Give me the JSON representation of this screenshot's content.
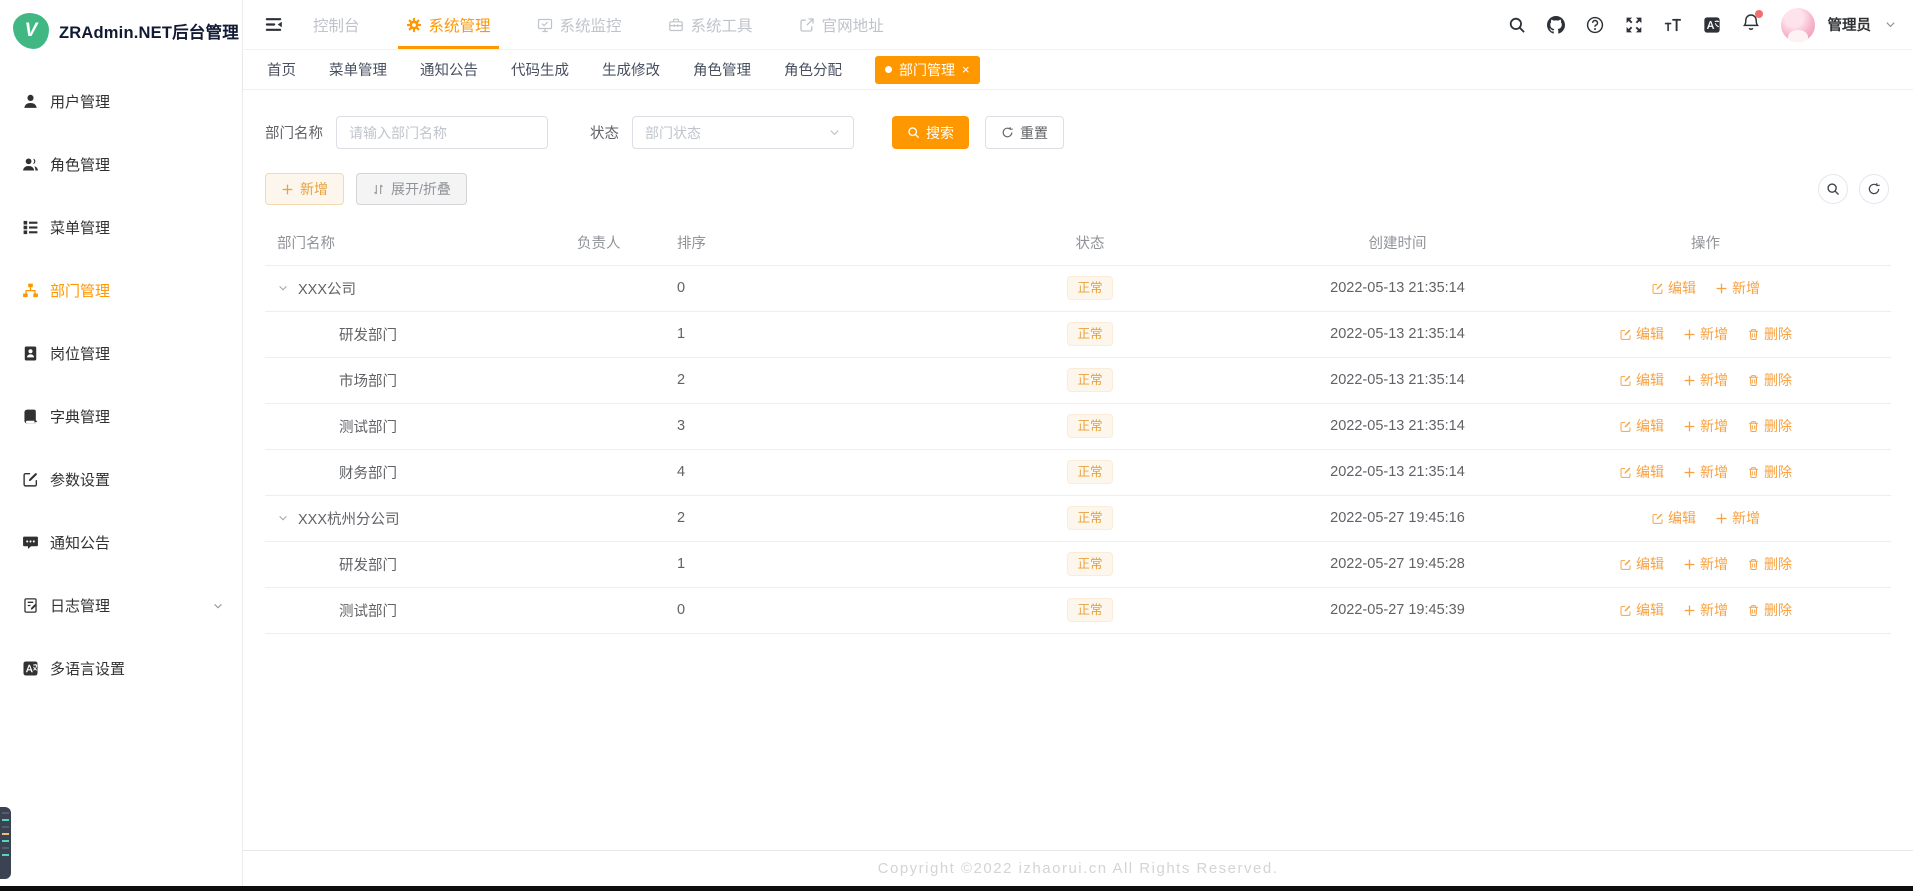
{
  "app": {
    "title": "ZRAdmin.NET后台管理",
    "logo_letter": "V"
  },
  "colors": {
    "accent": "#ff9700",
    "logo_green": "#41b883",
    "tag_text": "#e6a23c",
    "tag_bg": "#fdf6ec",
    "tag_border": "#faecd8",
    "link_orange": "#f9a13e",
    "badge_red": "#f56c6c"
  },
  "sidebar": {
    "items": [
      {
        "icon": "user-icon",
        "label": "用户管理",
        "active": false,
        "has_submenu": false
      },
      {
        "icon": "users-icon",
        "label": "角色管理",
        "active": false,
        "has_submenu": false
      },
      {
        "icon": "menu-tree-icon",
        "label": "菜单管理",
        "active": false,
        "has_submenu": false
      },
      {
        "icon": "org-icon",
        "label": "部门管理",
        "active": true,
        "has_submenu": false
      },
      {
        "icon": "badge-icon",
        "label": "岗位管理",
        "active": false,
        "has_submenu": false
      },
      {
        "icon": "book-icon",
        "label": "字典管理",
        "active": false,
        "has_submenu": false
      },
      {
        "icon": "edit-square-icon",
        "label": "参数设置",
        "active": false,
        "has_submenu": false
      },
      {
        "icon": "message-icon",
        "label": "通知公告",
        "active": false,
        "has_submenu": false
      },
      {
        "icon": "log-icon",
        "label": "日志管理",
        "active": false,
        "has_submenu": true
      },
      {
        "icon": "i18n-icon",
        "label": "多语言设置",
        "active": false,
        "has_submenu": false
      }
    ]
  },
  "topnav": {
    "items": [
      {
        "icon": null,
        "label": "控制台",
        "active": false
      },
      {
        "icon": "gear-icon",
        "label": "系统管理",
        "active": true
      },
      {
        "icon": "monitor-icon",
        "label": "系统监控",
        "active": false
      },
      {
        "icon": "toolbox-icon",
        "label": "系统工具",
        "active": false
      },
      {
        "icon": "external-link-icon",
        "label": "官网地址",
        "active": false
      }
    ]
  },
  "user": {
    "name": "管理员"
  },
  "tabs": {
    "items": [
      {
        "label": "首页",
        "active": false
      },
      {
        "label": "菜单管理",
        "active": false
      },
      {
        "label": "通知公告",
        "active": false
      },
      {
        "label": "代码生成",
        "active": false
      },
      {
        "label": "生成修改",
        "active": false
      },
      {
        "label": "角色管理",
        "active": false
      },
      {
        "label": "角色分配",
        "active": false
      },
      {
        "label": "部门管理",
        "active": true,
        "closable": true
      }
    ]
  },
  "filter": {
    "dept_label": "部门名称",
    "dept_placeholder": "请输入部门名称",
    "dept_value": "",
    "status_label": "状态",
    "status_placeholder": "部门状态",
    "search_label": "搜索",
    "reset_label": "重置"
  },
  "toolbar": {
    "add_label": "新增",
    "expand_label": "展开/折叠"
  },
  "table": {
    "columns": [
      "部门名称",
      "负责人",
      "排序",
      "状态",
      "创建时间",
      "操作"
    ],
    "status_normal": "正常",
    "actions": {
      "edit": "编辑",
      "add": "新增",
      "delete": "删除"
    },
    "rows": [
      {
        "name": "XXX公司",
        "level": 0,
        "expandable": true,
        "leader": "",
        "sort": "0",
        "status": "正常",
        "created": "2022-05-13 21:35:14",
        "can_delete": false
      },
      {
        "name": "研发部门",
        "level": 1,
        "expandable": false,
        "leader": "",
        "sort": "1",
        "status": "正常",
        "created": "2022-05-13 21:35:14",
        "can_delete": true
      },
      {
        "name": "市场部门",
        "level": 1,
        "expandable": false,
        "leader": "",
        "sort": "2",
        "status": "正常",
        "created": "2022-05-13 21:35:14",
        "can_delete": true
      },
      {
        "name": "测试部门",
        "level": 1,
        "expandable": false,
        "leader": "",
        "sort": "3",
        "status": "正常",
        "created": "2022-05-13 21:35:14",
        "can_delete": true
      },
      {
        "name": "财务部门",
        "level": 1,
        "expandable": false,
        "leader": "",
        "sort": "4",
        "status": "正常",
        "created": "2022-05-13 21:35:14",
        "can_delete": true
      },
      {
        "name": "XXX杭州分公司",
        "level": 0,
        "expandable": true,
        "leader": "",
        "sort": "2",
        "status": "正常",
        "created": "2022-05-27 19:45:16",
        "can_delete": false
      },
      {
        "name": "研发部门",
        "level": 1,
        "expandable": false,
        "leader": "",
        "sort": "1",
        "status": "正常",
        "created": "2022-05-27 19:45:28",
        "can_delete": true
      },
      {
        "name": "测试部门",
        "level": 1,
        "expandable": false,
        "leader": "",
        "sort": "0",
        "status": "正常",
        "created": "2022-05-27 19:45:39",
        "can_delete": true
      }
    ]
  },
  "footer": {
    "copyright": "Copyright ©2022 izhaorui.cn All Rights Reserved."
  }
}
